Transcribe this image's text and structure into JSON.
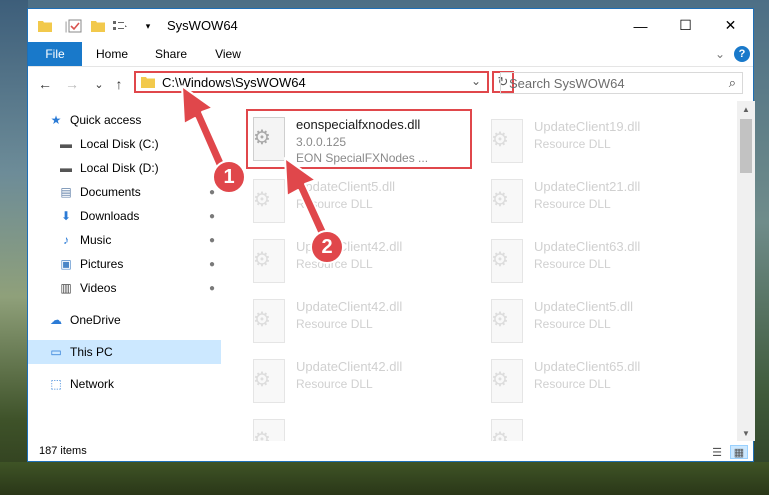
{
  "window": {
    "title": "SysWOW64"
  },
  "window_controls": {
    "minimize": "—",
    "maximize": "☐",
    "close": "✕"
  },
  "ribbon": {
    "tabs": [
      "File",
      "Home",
      "Share",
      "View"
    ],
    "collapse": "⌄",
    "help": "?"
  },
  "nav": {
    "back": "←",
    "forward": "→",
    "recent": "⌄",
    "up": "↑"
  },
  "address": {
    "path": "C:\\Windows\\SysWOW64",
    "dropdown": "⌄",
    "refresh": "↻"
  },
  "search": {
    "placeholder": "Search SysWOW64",
    "icon": "⌕"
  },
  "sidebar": {
    "items": [
      {
        "label": "Quick access",
        "icon": "★",
        "pinned": false
      },
      {
        "label": "Local Disk (C:)",
        "icon": "▬",
        "pinned": false
      },
      {
        "label": "Local Disk (D:)",
        "icon": "▬",
        "pinned": false
      },
      {
        "label": "Documents",
        "icon": "▤",
        "pinned": true
      },
      {
        "label": "Downloads",
        "icon": "⬇",
        "pinned": true
      },
      {
        "label": "Music",
        "icon": "♪",
        "pinned": true
      },
      {
        "label": "Pictures",
        "icon": "▣",
        "pinned": true
      },
      {
        "label": "Videos",
        "icon": "▥",
        "pinned": true
      },
      {
        "label": "OneDrive",
        "icon": "☁",
        "pinned": false
      },
      {
        "label": "This PC",
        "icon": "▭",
        "pinned": false
      },
      {
        "label": "Network",
        "icon": "⬚",
        "pinned": false
      }
    ],
    "pin_glyph": "📌"
  },
  "files": {
    "main": {
      "name": "eonspecialfxnodes.dll",
      "version": "3.0.0.125",
      "description": "EON SpecialFXNodes ..."
    },
    "faded": [
      {
        "name": "UpdateClient19.dll",
        "type": "Resource DLL"
      },
      {
        "name": "UpdateClient5.dll",
        "type": "Resource DLL"
      },
      {
        "name": "UpdateClient21.dll",
        "type": "Resource DLL"
      },
      {
        "name": "UpdateClient42.dll",
        "type": "Resource DLL"
      },
      {
        "name": "UpdateClient63.dll",
        "type": "Resource DLL"
      },
      {
        "name": "UpdateClient42.dll",
        "type": "Resource DLL"
      },
      {
        "name": "UpdateClient5.dll",
        "type": "Resource DLL"
      },
      {
        "name": "UpdateClient42.dll",
        "type": "Resource DLL"
      },
      {
        "name": "UpdateClient65.dll",
        "type": "Resource DLL"
      }
    ]
  },
  "status": {
    "count": "187 items"
  },
  "annotations": {
    "step1": "1",
    "step2": "2",
    "arrow_color": "#e0474b"
  }
}
